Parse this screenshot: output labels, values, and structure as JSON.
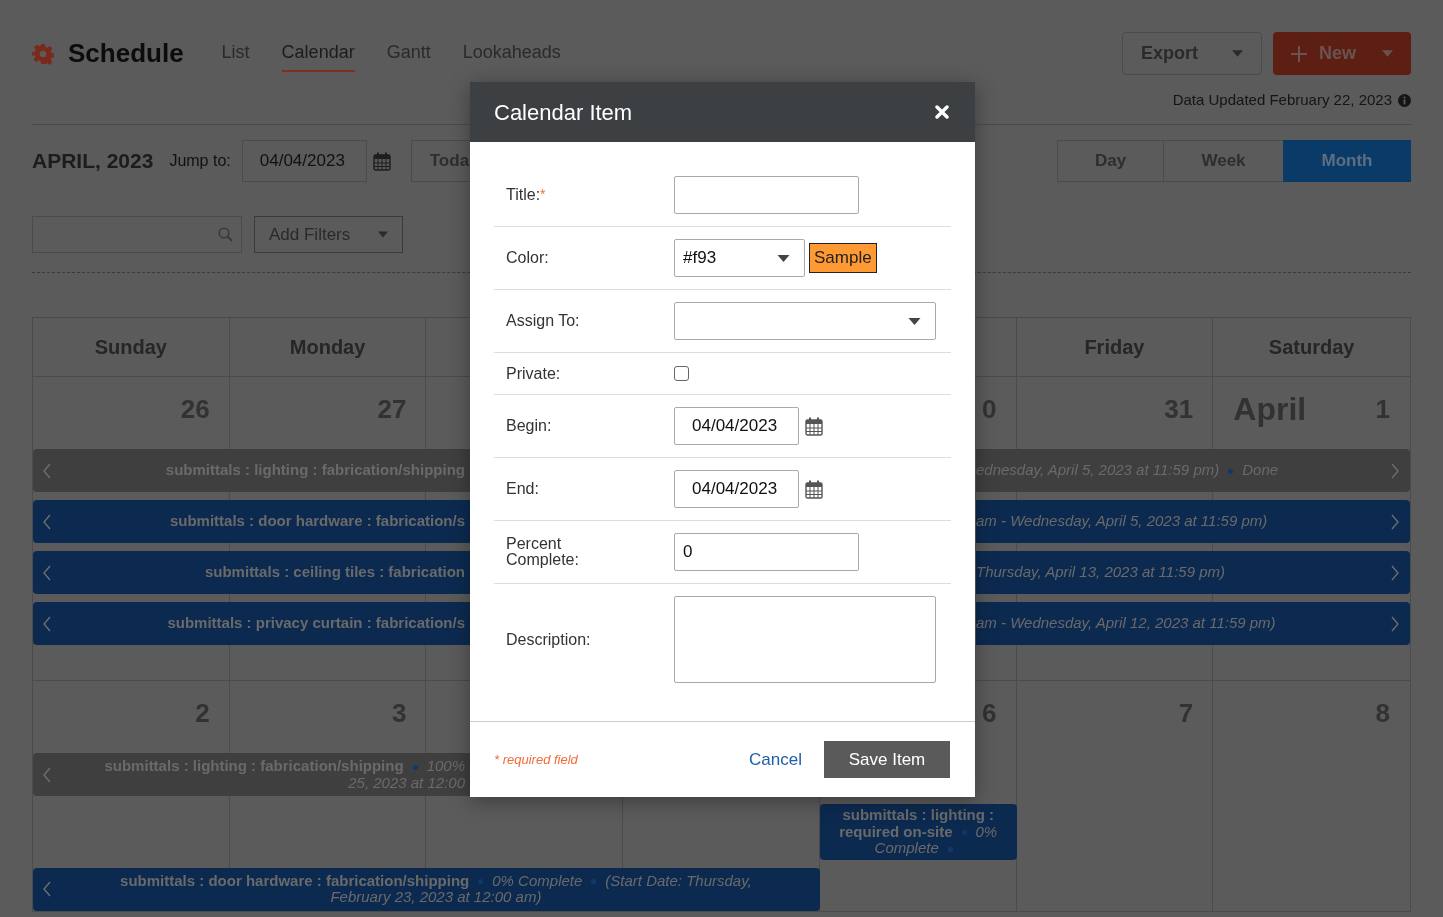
{
  "app": {
    "title": "Schedule",
    "tabs": [
      {
        "label": "List",
        "selected": false
      },
      {
        "label": "Calendar",
        "selected": true
      },
      {
        "label": "Gantt",
        "selected": false
      },
      {
        "label": "Lookaheads",
        "selected": false
      }
    ],
    "export_button": "Export",
    "new_button": "New",
    "data_updated": "Data Updated February 22, 2023"
  },
  "toolbar": {
    "month_label": "APRIL, 2023",
    "jump_label": "Jump to:",
    "jump_date": "04/04/2023",
    "today_button": "Toda",
    "views": [
      {
        "label": "Day",
        "selected": false
      },
      {
        "label": "Week",
        "selected": false
      },
      {
        "label": "Month",
        "selected": true
      }
    ],
    "filters_button": "Add Filters"
  },
  "calendar": {
    "weekdays": [
      "Sunday",
      "Monday",
      "Friday",
      "Saturday"
    ],
    "weeks": [
      {
        "days": [
          {
            "number": "26"
          },
          {
            "number": "27"
          },
          {
            "number": "0"
          },
          {
            "number": "31"
          },
          {
            "month": "April",
            "number": "1"
          }
        ],
        "events": [
          {
            "kind": "split",
            "color": "#403f40",
            "continues_before": true,
            "continues_after": true,
            "left": [
              {
                "kind": "title",
                "text": "submittals : lighting : fabrication/shipping"
              }
            ],
            "right": [
              {
                "kind": "detail",
                "text": "ednesday, April 5, 2023 at 11:59 pm)"
              },
              {
                "kind": "dot"
              },
              {
                "kind": "detail",
                "text": "Done"
              }
            ]
          },
          {
            "kind": "split",
            "color": "#0c2a50",
            "continues_before": true,
            "continues_after": true,
            "left": [
              {
                "kind": "title",
                "text": "submittals : door hardware : fabrication/s"
              }
            ],
            "right": [
              {
                "kind": "detail",
                "text": "am - Wednesday, April 5, 2023 at 11:59 pm)"
              }
            ]
          },
          {
            "kind": "split",
            "color": "#0c2a50",
            "continues_before": true,
            "continues_after": true,
            "left": [
              {
                "kind": "title",
                "text": "submittals : ceiling tiles : fabrication"
              }
            ],
            "right": [
              {
                "kind": "detail",
                "text": "Thursday, April 13, 2023 at 11:59 pm)"
              }
            ]
          },
          {
            "kind": "split",
            "color": "#0c2a50",
            "continues_before": true,
            "continues_after": true,
            "left": [
              {
                "kind": "title",
                "text": "submittals : privacy curtain : fabrication/s"
              }
            ],
            "right": [
              {
                "kind": "detail",
                "text": "am - Wednesday, April 12, 2023 at 11:59 pm)"
              }
            ]
          }
        ]
      },
      {
        "days": [
          {
            "number": "2"
          },
          {
            "number": "3"
          },
          {
            "number": "6"
          },
          {
            "number": "7"
          },
          {
            "number": "8"
          }
        ],
        "events": [
          {
            "kind": "split",
            "color": "#403f40",
            "continues_before": true,
            "left": [
              {
                "kind": "title",
                "text": "submittals : lighting : fabrication/shipping"
              },
              {
                "kind": "dot"
              },
              {
                "kind": "detail",
                "text": "100%"
              },
              {
                "kind": "break"
              },
              {
                "kind": "detail",
                "text": "25, 2023 at 12:00"
              }
            ]
          },
          {
            "kind": "whole",
            "color": "#0c2a50",
            "continues_before": false,
            "continues_after": false,
            "segments": [
              {
                "kind": "title",
                "text": "submittals : lighting :"
              },
              {
                "kind": "break"
              },
              {
                "kind": "title",
                "text": "required on-site"
              },
              {
                "kind": "dot"
              },
              {
                "kind": "detail",
                "text": "0%"
              },
              {
                "kind": "break"
              },
              {
                "kind": "detail",
                "text": "Complete"
              },
              {
                "kind": "dot"
              }
            ]
          },
          {
            "kind": "whole",
            "color": "#0c2a50",
            "continues_before": true,
            "continues_after": false,
            "segments": [
              {
                "kind": "title",
                "text": "submittals : door hardware : fabrication/shipping"
              },
              {
                "kind": "dot"
              },
              {
                "kind": "detail",
                "text": "0% Complete"
              },
              {
                "kind": "dot"
              },
              {
                "kind": "detail",
                "text": "(Start Date: Thursday,"
              },
              {
                "kind": "break"
              },
              {
                "kind": "detail",
                "text": "February 23, 2023 at 12:00 am)"
              }
            ]
          }
        ]
      }
    ]
  },
  "modal": {
    "title": "Calendar Item",
    "fields": [
      {
        "kind": "text",
        "label": "Title:",
        "required_mark": "*"
      },
      {
        "kind": "color",
        "label": "Color:",
        "value": "#f93",
        "sample": "Sample",
        "color": "#ff9933"
      },
      {
        "kind": "select",
        "label": "Assign To:"
      },
      {
        "kind": "checkbox",
        "label": "Private:",
        "checked": false
      },
      {
        "kind": "date",
        "label": "Begin:",
        "value": "04/04/2023"
      },
      {
        "kind": "date",
        "label": "End:",
        "value": "04/04/2023"
      },
      {
        "kind": "text",
        "label": "Percent Complete:",
        "value": "0"
      },
      {
        "kind": "textarea",
        "label": "Description:"
      }
    ],
    "required_note": "* required field",
    "cancel": "Cancel",
    "save": "Save Item"
  }
}
